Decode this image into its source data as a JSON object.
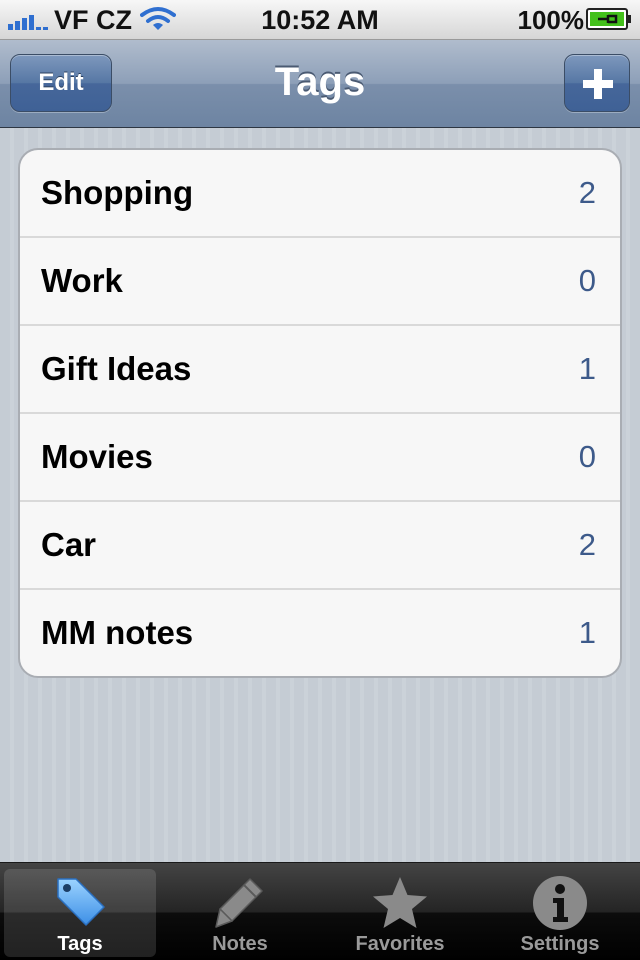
{
  "status_bar": {
    "carrier": "VF CZ",
    "time": "10:52 AM",
    "battery": "100%"
  },
  "nav_bar": {
    "title": "Tags",
    "edit_label": "Edit",
    "add_icon": "plus-icon"
  },
  "tags": [
    {
      "name": "Shopping",
      "count": "2"
    },
    {
      "name": "Work",
      "count": "0"
    },
    {
      "name": "Gift Ideas",
      "count": "1"
    },
    {
      "name": "Movies",
      "count": "0"
    },
    {
      "name": "Car",
      "count": "2"
    },
    {
      "name": "MM notes",
      "count": "1"
    }
  ],
  "tab_bar": {
    "tabs": [
      {
        "label": "Tags",
        "icon": "tag-icon",
        "active": true
      },
      {
        "label": "Notes",
        "icon": "pencil-icon",
        "active": false
      },
      {
        "label": "Favorites",
        "icon": "star-icon",
        "active": false
      },
      {
        "label": "Settings",
        "icon": "info-icon",
        "active": false
      }
    ]
  },
  "colors": {
    "nav_bar": "#8d9fb8",
    "count_text": "#3d5a8a",
    "active_tag_icon": "#58a8f0"
  }
}
